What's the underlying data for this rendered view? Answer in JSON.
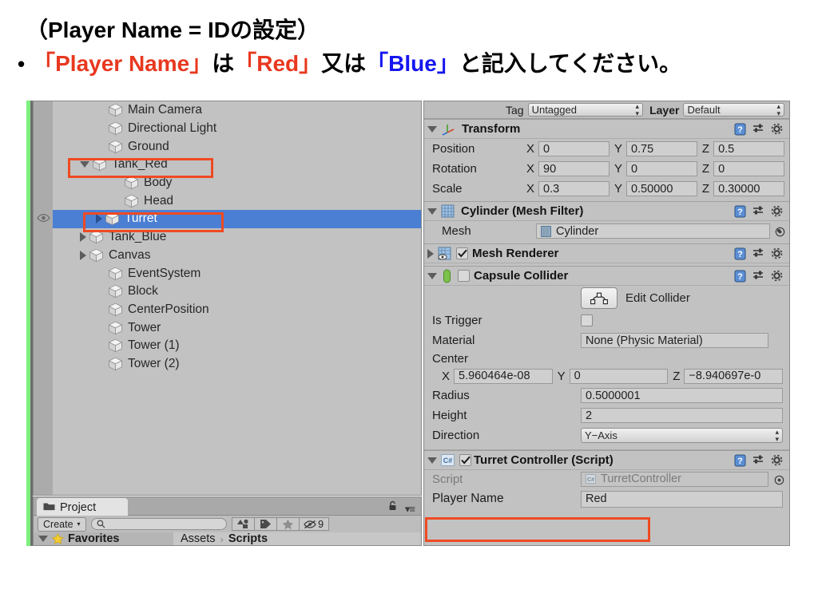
{
  "header": {
    "line1": "（Player Name = IDの設定）",
    "bullet": "•",
    "line2_parts": {
      "p1": "「Player Name」",
      "p2": " は ",
      "p3": "「Red」",
      "p4": " 又は ",
      "p5": "「Blue」",
      "p6": " と記入してください。"
    },
    "colors": {
      "red": "#e8381f",
      "blue": "#1515f0",
      "black": "#000000"
    }
  },
  "hierarchy": {
    "items": [
      {
        "label": "Main Camera",
        "indent": 2,
        "toggle": "none",
        "selected": false,
        "eye": false
      },
      {
        "label": "Directional Light",
        "indent": 2,
        "toggle": "none",
        "selected": false,
        "eye": false
      },
      {
        "label": "Ground",
        "indent": 2,
        "toggle": "none",
        "selected": false,
        "eye": false
      },
      {
        "label": "Tank_Red",
        "indent": 1,
        "toggle": "down",
        "selected": false,
        "eye": false
      },
      {
        "label": "Body",
        "indent": 3,
        "toggle": "none",
        "selected": false,
        "eye": false
      },
      {
        "label": "Head",
        "indent": 3,
        "toggle": "none",
        "selected": false,
        "eye": false
      },
      {
        "label": "Turret",
        "indent": 2,
        "toggle": "right",
        "selected": true,
        "eye": true
      },
      {
        "label": "Tank_Blue",
        "indent": 1,
        "toggle": "right",
        "selected": false,
        "eye": false
      },
      {
        "label": "Canvas",
        "indent": 1,
        "toggle": "right",
        "selected": false,
        "eye": false
      },
      {
        "label": "EventSystem",
        "indent": 2,
        "toggle": "none",
        "selected": false,
        "eye": false
      },
      {
        "label": "Block",
        "indent": 2,
        "toggle": "none",
        "selected": false,
        "eye": false
      },
      {
        "label": "CenterPosition",
        "indent": 2,
        "toggle": "none",
        "selected": false,
        "eye": false
      },
      {
        "label": "Tower",
        "indent": 2,
        "toggle": "none",
        "selected": false,
        "eye": false
      },
      {
        "label": "Tower (1)",
        "indent": 2,
        "toggle": "none",
        "selected": false,
        "eye": false
      },
      {
        "label": "Tower (2)",
        "indent": 2,
        "toggle": "none",
        "selected": false,
        "eye": false
      }
    ]
  },
  "project": {
    "tab_label": "Project",
    "create_label": "Create",
    "create_caret": "▾",
    "search_value": "",
    "hidden_count": "9",
    "favorites_label": "Favorites",
    "breadcrumb": {
      "root": "Assets",
      "sep": "›",
      "current": "Scripts"
    }
  },
  "inspector": {
    "tag_label": "Tag",
    "tag_value": "Untagged",
    "layer_label": "Layer",
    "layer_value": "Default",
    "transform": {
      "title": "Transform",
      "rows": [
        {
          "label": "Position",
          "x": "0",
          "y": "0.75",
          "z": "0.5"
        },
        {
          "label": "Rotation",
          "x": "90",
          "y": "0",
          "z": "0"
        },
        {
          "label": "Scale",
          "x": "0.3",
          "y": "0.50000",
          "z": "0.30000"
        }
      ],
      "axis_x": "X",
      "axis_y": "Y",
      "axis_z": "Z"
    },
    "mesh_filter": {
      "title": "Cylinder (Mesh Filter)",
      "mesh_label": "Mesh",
      "mesh_value": "Cylinder"
    },
    "mesh_renderer": {
      "title": "Mesh Renderer",
      "enabled": true
    },
    "capsule_collider": {
      "title": "Capsule Collider",
      "enabled": false,
      "edit_collider_label": "Edit Collider",
      "is_trigger_label": "Is Trigger",
      "is_trigger_value": false,
      "material_label": "Material",
      "material_value": "None (Physic Material)",
      "center_label": "Center",
      "center_x": "5.960464e-08",
      "center_y": "0",
      "center_z": "−8.940697e-0",
      "radius_label": "Radius",
      "radius_value": "0.5000001",
      "height_label": "Height",
      "height_value": "2",
      "direction_label": "Direction",
      "direction_value": "Y−Axis"
    },
    "turret_controller": {
      "title": "Turret Controller (Script)",
      "enabled": true,
      "script_label": "Script",
      "script_value": "TurretController",
      "player_name_label": "Player Name",
      "player_name_value": "Red"
    }
  },
  "callouts": {
    "highlight_color": "#ef4a22",
    "boxes": [
      "tank-red-row",
      "turret-row",
      "player-name-field"
    ]
  }
}
